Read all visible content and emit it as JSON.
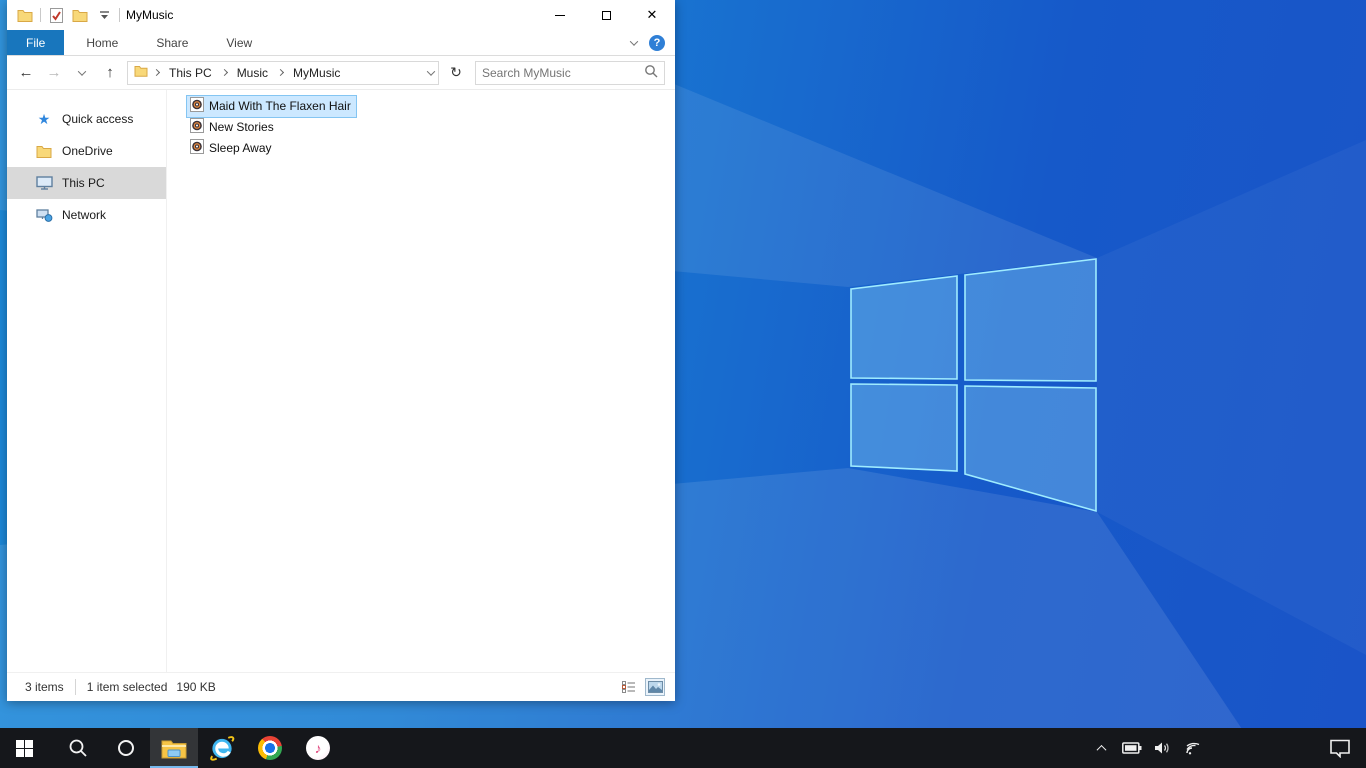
{
  "explorer": {
    "title": "MyMusic",
    "window_controls": {
      "close_glyph": "✕"
    },
    "tabs": [
      {
        "label": "File",
        "active": true
      },
      {
        "label": "Home",
        "active": false
      },
      {
        "label": "Share",
        "active": false
      },
      {
        "label": "View",
        "active": false
      }
    ],
    "help_glyph": "?",
    "nav": {
      "back": "←",
      "forward": "→",
      "up": "↑",
      "refresh": "↻"
    },
    "breadcrumb": {
      "items": [
        "This PC",
        "Music",
        "MyMusic"
      ]
    },
    "search_placeholder": "Search MyMusic",
    "sidebar": [
      {
        "label": "Quick access",
        "icon": "quick-access-star",
        "selected": false
      },
      {
        "label": "OneDrive",
        "icon": "onedrive-folder",
        "selected": false
      },
      {
        "label": "This PC",
        "icon": "this-pc-monitor",
        "selected": true
      },
      {
        "label": "Network",
        "icon": "network-computer",
        "selected": false
      }
    ],
    "files": [
      {
        "name": "Maid With The Flaxen Hair",
        "selected": true
      },
      {
        "name": "New Stories",
        "selected": false
      },
      {
        "name": "Sleep Away",
        "selected": false
      }
    ],
    "status": {
      "count": "3 items",
      "selected": "1 item selected",
      "size": "190 KB"
    }
  },
  "taskbar": {
    "ie_glyph": "e",
    "itunes_glyph": "♪"
  },
  "colors": {
    "wallpaper_left": "#1d8ad9",
    "wallpaper_right": "#1a54c8",
    "file_tab_blue": "#1876bd",
    "selection_blue_bg": "#cce8ff",
    "selection_blue_border": "#84c5f2",
    "sidebar_selected_gray": "#d9d9d9",
    "taskbar_dark": "#15171b",
    "taskbar_underline": "#76b9ed"
  }
}
